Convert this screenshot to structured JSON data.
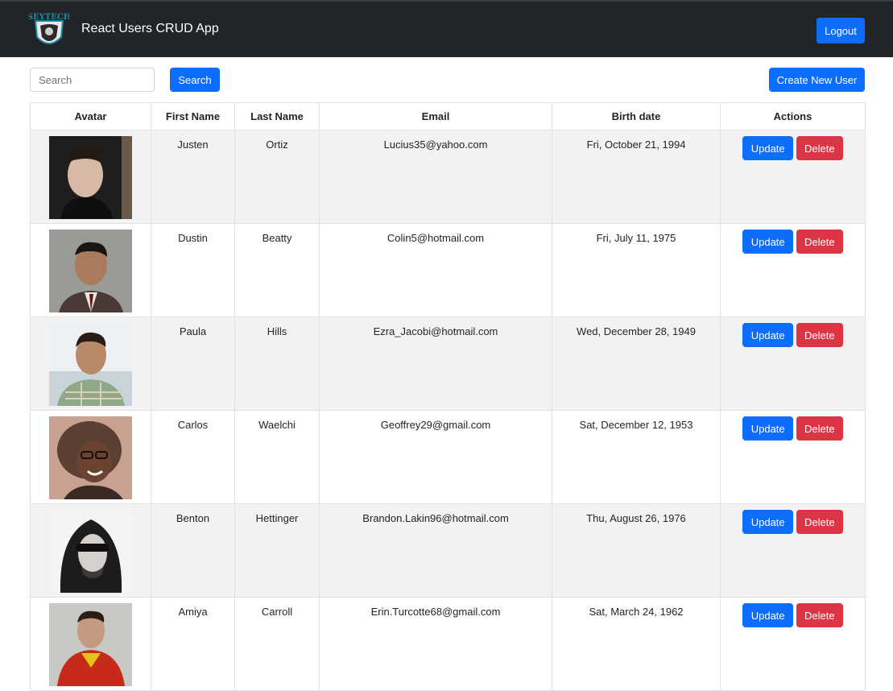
{
  "app": {
    "title": "React Users CRUD App",
    "logo_text": "SEYTECH",
    "logout_label": "Logout"
  },
  "toolbar": {
    "search_placeholder": "Search",
    "search_button": "Search",
    "create_button": "Create New User"
  },
  "table": {
    "headers": [
      "Avatar",
      "First Name",
      "Last Name",
      "Email",
      "Birth date",
      "Actions"
    ],
    "update_label": "Update",
    "delete_label": "Delete",
    "rows": [
      {
        "first_name": "Justen",
        "last_name": "Ortiz",
        "email": "Lucius35@yahoo.com",
        "birth_date": "Fri, October 21, 1994"
      },
      {
        "first_name": "Dustin",
        "last_name": "Beatty",
        "email": "Colin5@hotmail.com",
        "birth_date": "Fri, July 11, 1975"
      },
      {
        "first_name": "Paula",
        "last_name": "Hills",
        "email": "Ezra_Jacobi@hotmail.com",
        "birth_date": "Wed, December 28, 1949"
      },
      {
        "first_name": "Carlos",
        "last_name": "Waelchi",
        "email": "Geoffrey29@gmail.com",
        "birth_date": "Sat, December 12, 1953"
      },
      {
        "first_name": "Benton",
        "last_name": "Hettinger",
        "email": "Brandon.Lakin96@hotmail.com",
        "birth_date": "Thu, August 26, 1976"
      },
      {
        "first_name": "Amiya",
        "last_name": "Carroll",
        "email": "Erin.Turcotte68@gmail.com",
        "birth_date": "Sat, March 24, 1962"
      }
    ]
  },
  "colors": {
    "navbar": "#212529",
    "primary": "#0d6efd",
    "danger": "#dc3545",
    "stripe": "#f2f2f2"
  }
}
